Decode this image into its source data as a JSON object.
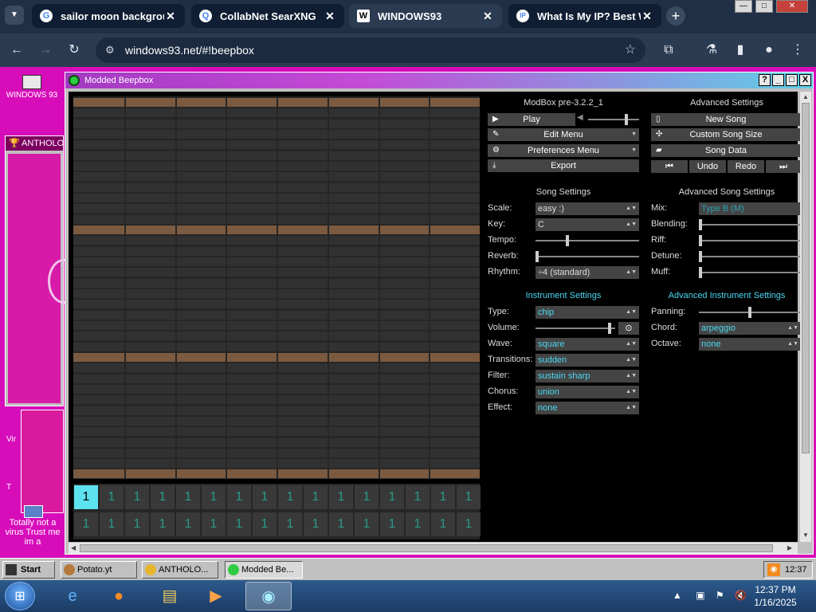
{
  "browser": {
    "tabs": [
      {
        "label": "sailor moon backgroun",
        "favicon": "G",
        "active": false
      },
      {
        "label": "CollabNet SearXNG",
        "favicon": "Q",
        "active": false
      },
      {
        "label": "WINDOWS93",
        "favicon": "W",
        "active": true
      },
      {
        "label": "What Is My IP? Best Wa",
        "favicon": "IP",
        "active": false
      }
    ],
    "close_glyph": "✕",
    "new_tab_glyph": "+",
    "url": "windows93.net/#!beepbox"
  },
  "desktop": {
    "icon_label": "WINDOWS 93",
    "anthology_title": "ANTHOLO",
    "side_texts": [
      "Vir",
      "T"
    ],
    "virus_note": "Totally not a virus Trust me im a"
  },
  "beepbox": {
    "window_title": "Modded Beepbox",
    "title_buttons": [
      "?",
      "_",
      "□",
      "X"
    ],
    "track_value": "1",
    "main": {
      "version": "ModBox pre-3.2.2_1",
      "play": "Play",
      "edit_menu": "Edit Menu",
      "preferences_menu": "Preferences Menu",
      "export": "Export"
    },
    "advanced": {
      "heading": "Advanced Settings",
      "new_song": "New Song",
      "custom_song_size": "Custom Song Size",
      "song_data": "Song Data",
      "undo": "Undo",
      "redo": "Redo"
    },
    "song_settings": {
      "heading": "Song Settings",
      "scale_label": "Scale:",
      "scale": "easy :)",
      "key_label": "Key:",
      "key": "C",
      "tempo_label": "Tempo:",
      "tempo_level": 0.3,
      "reverb_label": "Reverb:",
      "reverb_level": 0.0,
      "rhythm_label": "Rhythm:",
      "rhythm": "÷4 (standard)"
    },
    "advanced_song_settings": {
      "heading": "Advanced Song Settings",
      "mix_label": "Mix:",
      "mix": "Type B (M)",
      "blending_label": "Blending:",
      "blending_level": 0.0,
      "riff_label": "Riff:",
      "riff_level": 0.0,
      "detune_label": "Detune:",
      "detune_level": 0.0,
      "muff_label": "Muff:",
      "muff_level": 0.0
    },
    "instrument_settings": {
      "heading": "Instrument Settings",
      "type_label": "Type:",
      "type": "chip",
      "volume_label": "Volume:",
      "volume_level": 0.95,
      "volume_button": "⊙",
      "wave_label": "Wave:",
      "wave": "square",
      "transitions_label": "Transitions:",
      "transitions": "sudden",
      "filter_label": "Filter:",
      "filter": "sustain sharp",
      "chorus_label": "Chorus:",
      "chorus": "union",
      "effect_label": "Effect:",
      "effect": "none"
    },
    "advanced_instrument_settings": {
      "heading": "Advanced Instrument Settings",
      "panning_label": "Panning:",
      "panning_level": 0.5,
      "chord_label": "Chord:",
      "chord": "arpeggio",
      "octave_label": "Octave:",
      "octave": "none"
    }
  },
  "taskbar93": {
    "start": "Start",
    "items": [
      "Potato.yt",
      "ANTHOLO...",
      "Modded Be..."
    ],
    "clock": "12:37"
  },
  "win7": {
    "time": "12:37 PM",
    "date": "1/16/2025"
  },
  "colors": {
    "desktop": "#d70dba",
    "accent_cyan": "#5de2ef",
    "octave_row": "#7b5a40"
  }
}
